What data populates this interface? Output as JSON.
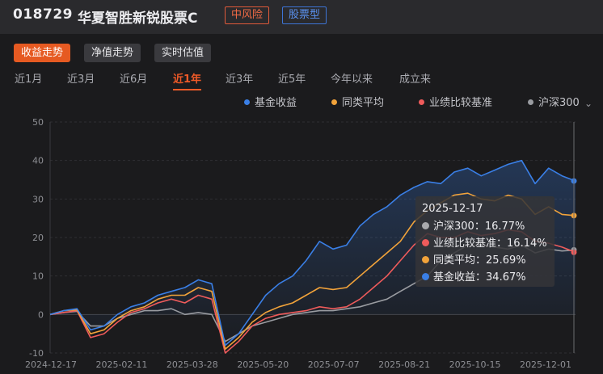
{
  "header": {
    "code": "018729",
    "name": "华夏智胜新锐股票C",
    "risk_badge": "中风险",
    "type_badge": "股票型"
  },
  "modes": [
    {
      "label": "收益走势",
      "active": true
    },
    {
      "label": "净值走势",
      "active": false
    },
    {
      "label": "实时估值",
      "active": false
    }
  ],
  "ranges": [
    {
      "label": "近1月",
      "active": false
    },
    {
      "label": "近3月",
      "active": false
    },
    {
      "label": "近6月",
      "active": false
    },
    {
      "label": "近1年",
      "active": true
    },
    {
      "label": "近3年",
      "active": false
    },
    {
      "label": "近5年",
      "active": false
    },
    {
      "label": "今年以来",
      "active": false
    },
    {
      "label": "成立来",
      "active": false
    }
  ],
  "legend": [
    {
      "name": "基金收益",
      "color": "#3a7fe6"
    },
    {
      "name": "同类平均",
      "color": "#f2a33a"
    },
    {
      "name": "业绩比较基准",
      "color": "#ef5b5b"
    },
    {
      "name": "沪深300",
      "color": "#9a9ca1"
    }
  ],
  "legend_more_icon": "chevron-down-icon",
  "tooltip": {
    "date": "2025-12-17",
    "rows": [
      {
        "name": "沪深300",
        "value": "16.77%",
        "color": "#a8a9ad"
      },
      {
        "name": "业绩比较基准",
        "value": "16.14%",
        "color": "#ef5b5b"
      },
      {
        "name": "同类平均",
        "value": "25.69%",
        "color": "#f2a33a"
      },
      {
        "name": "基金收益",
        "value": "34.67%",
        "color": "#3a7fe6"
      }
    ]
  },
  "chart_data": {
    "type": "line",
    "y_ticks": [
      "50",
      "40",
      "30",
      "20",
      "10",
      "0",
      "-10"
    ],
    "ylim": [
      -10,
      50
    ],
    "x_ticks": [
      "2024-12-17",
      "2025-02-11",
      "2025-03-28",
      "2025-05-20",
      "2025-07-07",
      "2025-08-21",
      "2025-10-15",
      "2025-12-01"
    ],
    "grid": true,
    "series": [
      {
        "name": "基金收益",
        "color": "#3a7fe6",
        "values": [
          0,
          1,
          1.5,
          -4,
          -3,
          0,
          2,
          3,
          5,
          6,
          7,
          9,
          8,
          -8,
          -5,
          0,
          5,
          8,
          10,
          14,
          19,
          17,
          18,
          23,
          26,
          28,
          31,
          33,
          34.5,
          34,
          37,
          38,
          36,
          37.5,
          39,
          40,
          34,
          38,
          36,
          34.67
        ]
      },
      {
        "name": "同类平均",
        "color": "#f2a33a",
        "values": [
          0,
          1,
          1.2,
          -5,
          -4,
          -1,
          1,
          2,
          4,
          5,
          5,
          7,
          6,
          -9,
          -6,
          -2,
          0.5,
          2,
          3,
          5,
          7,
          6.5,
          7,
          10,
          13,
          16,
          19,
          24,
          27,
          29,
          31,
          31.5,
          30,
          29.5,
          31,
          30,
          26,
          28,
          26,
          25.69
        ]
      },
      {
        "name": "业绩比较基准",
        "color": "#ef5b5b",
        "values": [
          0,
          0.5,
          1,
          -6,
          -5,
          -2,
          0.5,
          1.5,
          3,
          4,
          3,
          5,
          4,
          -10,
          -7,
          -3,
          -1,
          0,
          0.5,
          1,
          2,
          1.5,
          2,
          4,
          7,
          10,
          14,
          18,
          21,
          20,
          20,
          21.5,
          20.5,
          21,
          22,
          21.5,
          19,
          18.5,
          17.5,
          16.14
        ]
      },
      {
        "name": "沪深300",
        "color": "#9a9ca1",
        "values": [
          0,
          0.5,
          0.8,
          -3,
          -3,
          -1,
          0,
          1,
          1,
          1.5,
          0,
          0.5,
          0,
          -7,
          -5,
          -3,
          -2,
          -1,
          0,
          0.5,
          1,
          1,
          1.5,
          2,
          3,
          4,
          6,
          8,
          10,
          14,
          16,
          18,
          18,
          17.5,
          17,
          18,
          16,
          17,
          16.5,
          16.77
        ]
      }
    ]
  }
}
